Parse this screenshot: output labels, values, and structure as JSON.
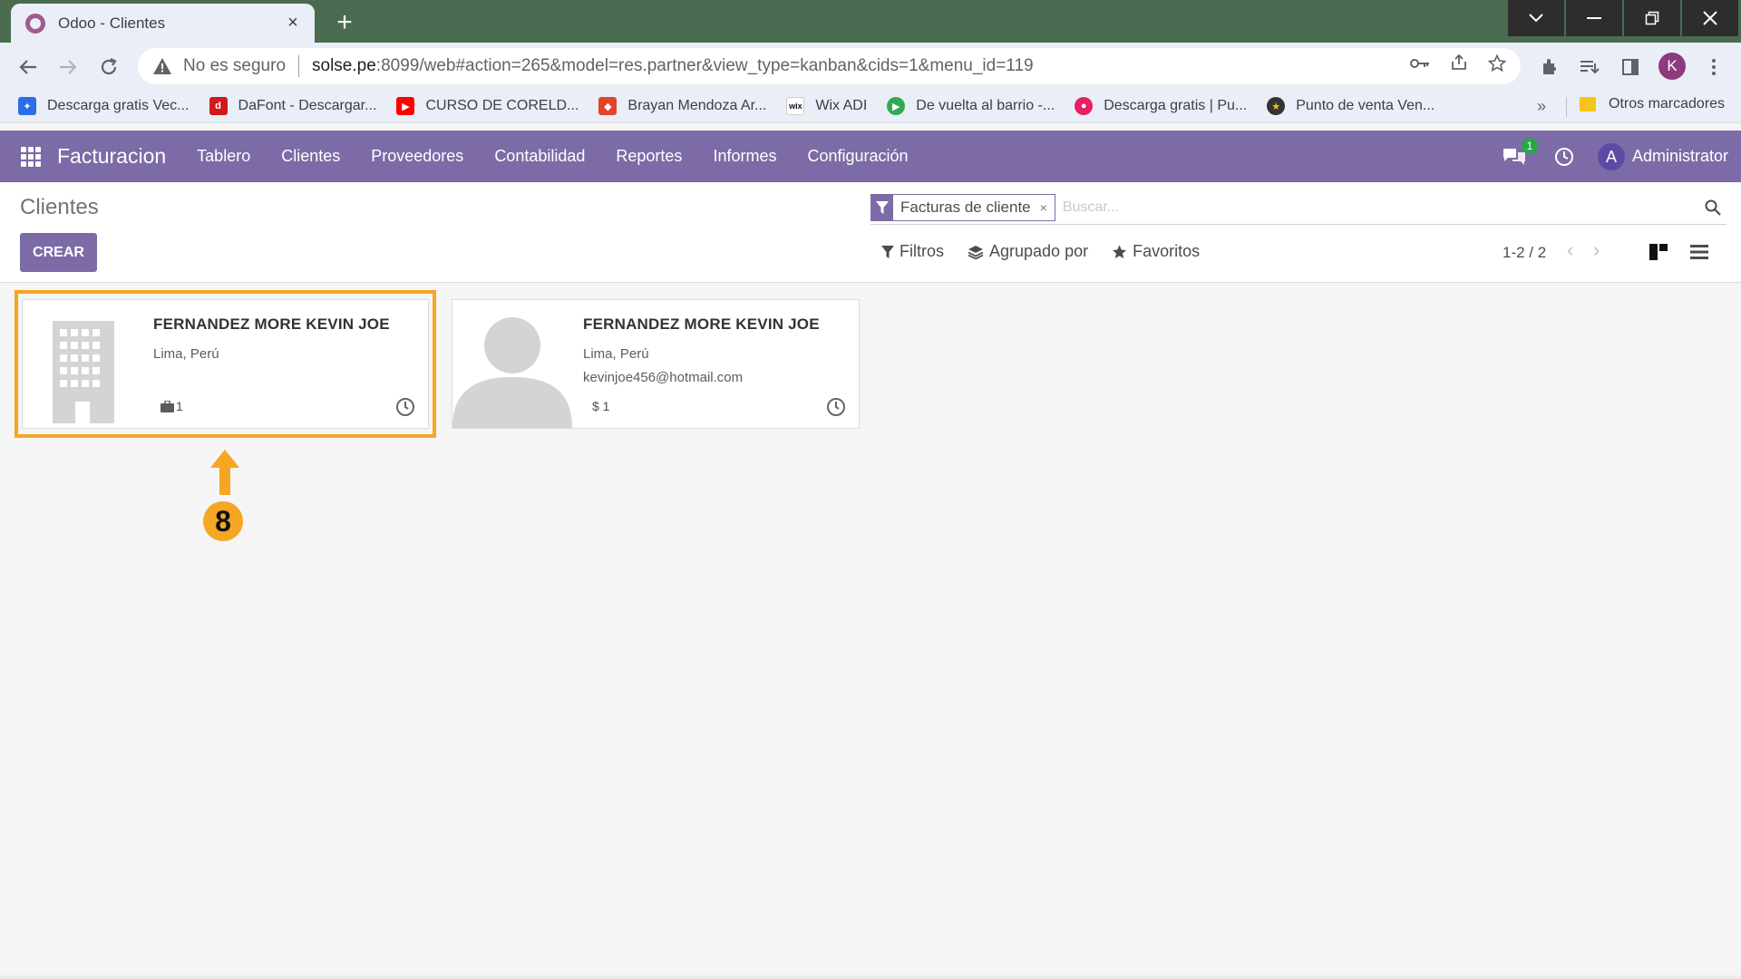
{
  "browser": {
    "tab_title": "Odoo - Clientes",
    "tab_close": "×",
    "new_tab": "+",
    "security_label": "No es seguro",
    "url_host": "solse.pe",
    "url_rest": ":8099/web#action=265&model=res.partner&view_type=kanban&cids=1&menu_id=119",
    "profile_initial": "K",
    "bookmarks": [
      {
        "label": "Descarga gratis Vec...",
        "icon": "freepik-icon",
        "color": "#2a6ee8"
      },
      {
        "label": "DaFont - Descargar...",
        "icon": "dafont-icon",
        "color": "#d0191b"
      },
      {
        "label": "CURSO DE CORELD...",
        "icon": "youtube-icon",
        "color": "#ff0000"
      },
      {
        "label": "Brayan Mendoza Ar...",
        "icon": "gitlab-icon",
        "color": "#e24329"
      },
      {
        "label": "Wix ADI",
        "icon": "wix-icon",
        "color": "#111111"
      },
      {
        "label": "De vuelta al barrio -...",
        "icon": "play-icon",
        "color": "#34a853"
      },
      {
        "label": "Descarga gratis | Pu...",
        "icon": "drop-icon",
        "color": "#e91e63"
      },
      {
        "label": "Punto de venta Ven...",
        "icon": "star-badge-icon",
        "color": "#333333"
      }
    ],
    "bookmarks_more": "»",
    "other_bookmarks": "Otros marcadores"
  },
  "navbar": {
    "brand": "Facturacion",
    "menu": [
      "Tablero",
      "Clientes",
      "Proveedores",
      "Contabilidad",
      "Reportes",
      "Informes",
      "Configuración"
    ],
    "messages_count": "1",
    "user_initial": "A",
    "user_name": "Administrator"
  },
  "control": {
    "title": "Clientes",
    "create_label": "CREAR",
    "facet_label": "Facturas de cliente",
    "facet_remove": "×",
    "search_placeholder": "Buscar...",
    "filters_label": "Filtros",
    "groupby_label": "Agrupado por",
    "favorites_label": "Favoritos",
    "pager": "1-2 / 2"
  },
  "cards": [
    {
      "name": "FERNANDEZ MORE KEVIN JOE",
      "location": "Lima, Perú",
      "email": "",
      "stat": "1",
      "stat_icon": "briefcase-icon",
      "image": "company-building"
    },
    {
      "name": "FERNANDEZ MORE KEVIN JOE",
      "location": "Lima, Perú",
      "email": "kevinjoe456@hotmail.com",
      "stat": "$ 1",
      "stat_icon": "",
      "image": "person-placeholder"
    }
  ],
  "annotation": {
    "step_number": "8",
    "color": "#f5a623"
  },
  "colors": {
    "odoo_primary": "#7c6ba6",
    "chrome_frame": "#4a6b50",
    "highlight": "#f5a623"
  }
}
